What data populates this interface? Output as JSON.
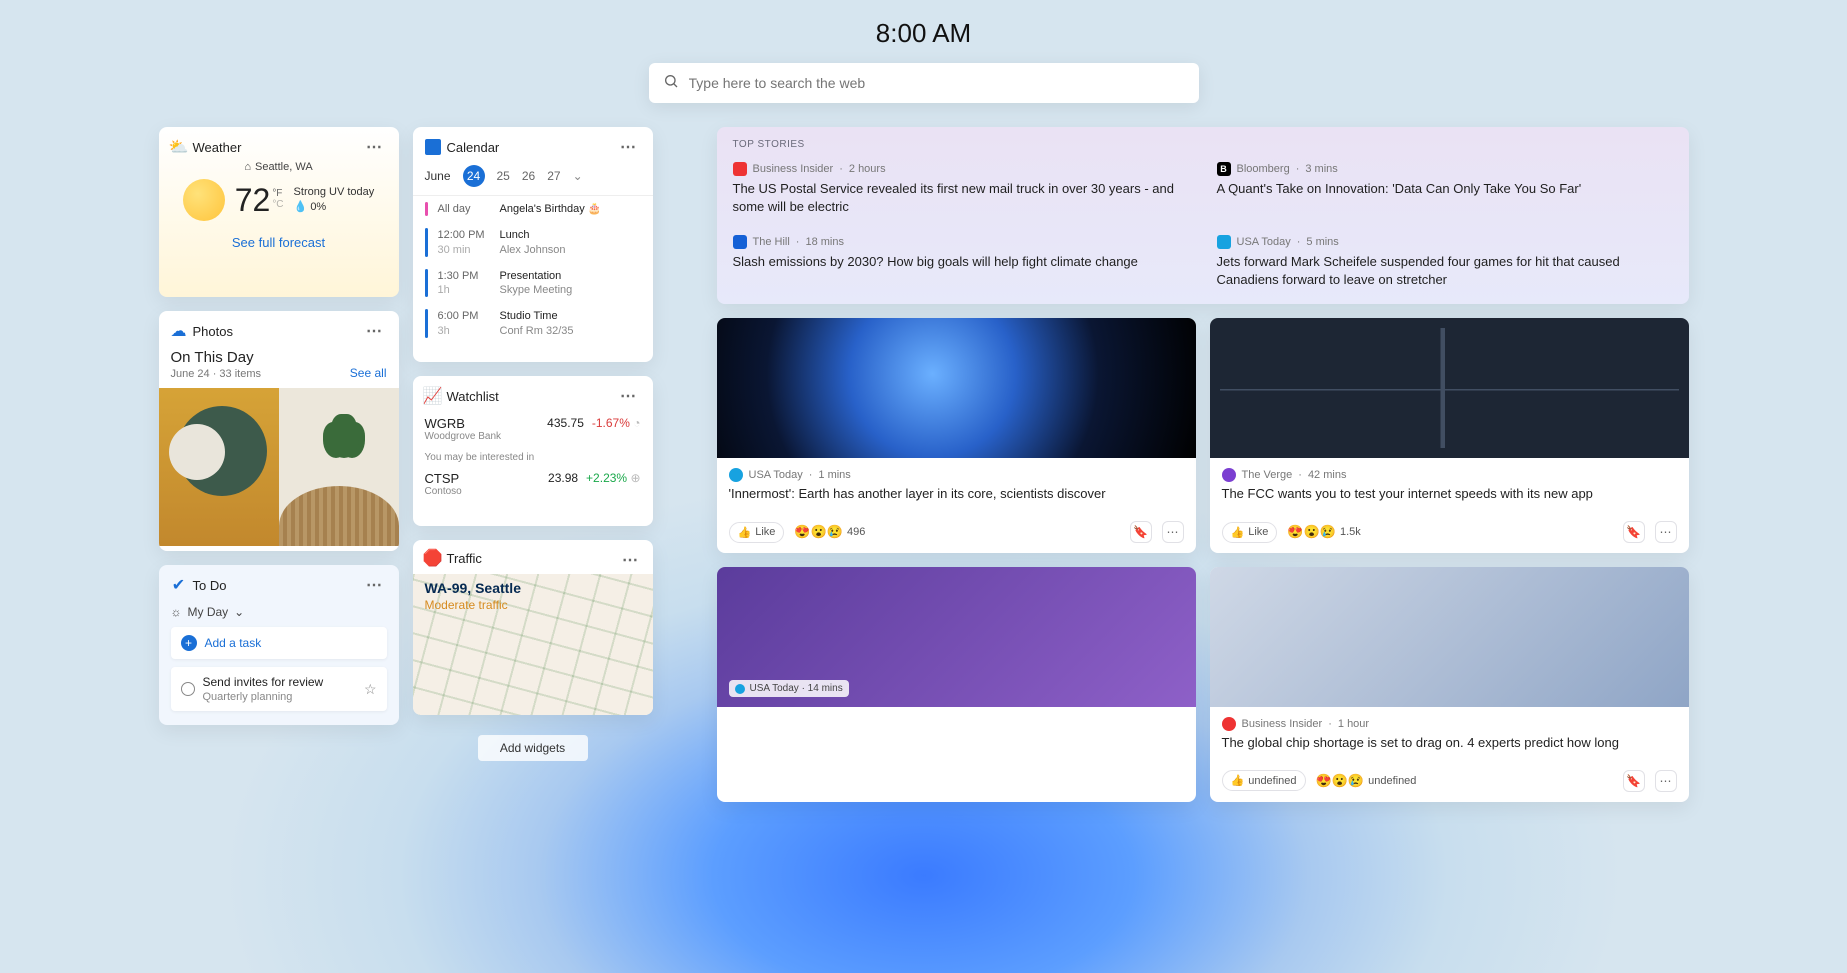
{
  "clock": "8:00 AM",
  "search": {
    "placeholder": "Type here to search the web"
  },
  "add_widgets_label": "Add widgets",
  "weather": {
    "title": "Weather",
    "location": "Seattle, WA",
    "temp": "72",
    "unit_top": "°F",
    "unit_bottom": "°C",
    "condition": "Strong UV today",
    "precip": "0%",
    "link": "See full forecast"
  },
  "photos": {
    "title": "Photos",
    "heading": "On This Day",
    "meta": "June 24 · 33 items",
    "see_all": "See all"
  },
  "todo": {
    "title": "To Do",
    "my_day": "My Day",
    "add_task": "Add a task",
    "task_title": "Send invites for review",
    "task_sub": "Quarterly planning"
  },
  "calendar": {
    "title": "Calendar",
    "month": "June",
    "days": [
      "24",
      "25",
      "26",
      "27"
    ],
    "events": [
      {
        "bar": "pink",
        "time": "All day",
        "dur": "",
        "title": "Angela's Birthday 🎂",
        "sub": ""
      },
      {
        "bar": "blue",
        "time": "12:00 PM",
        "dur": "30 min",
        "title": "Lunch",
        "sub": "Alex Johnson"
      },
      {
        "bar": "blue",
        "time": "1:30 PM",
        "dur": "1h",
        "title": "Presentation",
        "sub": "Skype Meeting"
      },
      {
        "bar": "blue",
        "time": "6:00 PM",
        "dur": "3h",
        "title": "Studio Time",
        "sub": "Conf Rm 32/35"
      }
    ]
  },
  "watchlist": {
    "title": "Watchlist",
    "rows": [
      {
        "sym": "WGRB",
        "name": "Woodgrove Bank",
        "price": "435.75",
        "chg": "-1.67%",
        "dir": "neg"
      },
      {
        "sym": "CTSP",
        "name": "Contoso",
        "price": "23.98",
        "chg": "+2.23%",
        "dir": "pos"
      }
    ],
    "hint": "You may be interested in"
  },
  "traffic": {
    "title": "Traffic",
    "route": "WA-99, Seattle",
    "status": "Moderate traffic"
  },
  "top_stories": {
    "label": "TOP STORIES",
    "items": [
      {
        "logo_bg": "#e33",
        "logo_txt": "",
        "source": "Business Insider",
        "age": "2 hours",
        "headline": "The US Postal Service revealed its first new mail truck in over 30 years - and some will be electric"
      },
      {
        "logo_bg": "#000",
        "logo_txt": "B",
        "source": "Bloomberg",
        "age": "3 mins",
        "headline": "A Quant's Take on Innovation: 'Data Can Only Take You So Far'"
      },
      {
        "logo_bg": "#1460d6",
        "logo_txt": "",
        "source": "The Hill",
        "age": "18 mins",
        "headline": "Slash emissions by 2030? How big goals will help fight climate change"
      },
      {
        "logo_bg": "#17a2e0",
        "logo_txt": "",
        "source": "USA Today",
        "age": "5 mins",
        "headline": "Jets forward Mark Scheifele suspended four games for hit that caused Canadiens forward to leave on stretcher"
      }
    ]
  },
  "news": [
    {
      "img": "earth",
      "logo_bg": "#17a2e0",
      "source": "USA Today",
      "age": "1 mins",
      "title": "'Innermost': Earth has another layer in its core, scientists discover",
      "like": "Like",
      "react_count": "496"
    },
    {
      "img": "usmap",
      "logo_bg": "#7b3fd1",
      "source": "The Verge",
      "age": "42 mins",
      "title": "The FCC wants you to test your internet speeds with its new app",
      "like": "Like",
      "react_count": "1.5k"
    }
  ],
  "news2": [
    {
      "img": "party",
      "logo_bg": "#17a2e0",
      "source": "USA Today",
      "age": "14 mins"
    },
    {
      "img": "lab",
      "logo_bg": "#e33",
      "source": "Business Insider",
      "age": "1 hour",
      "title": "The global chip shortage is set to drag on. 4 experts predict how long"
    }
  ]
}
